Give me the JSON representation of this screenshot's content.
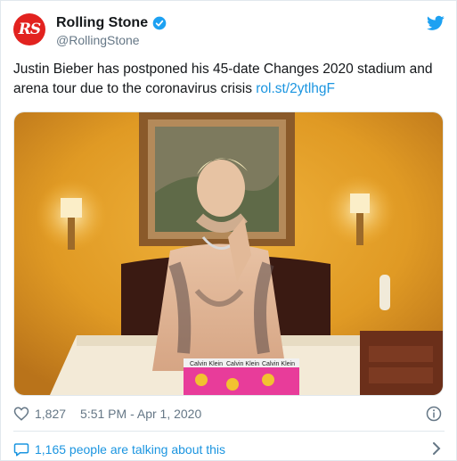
{
  "tweet": {
    "author": {
      "display_name": "Rolling Stone",
      "handle": "@RollingStone",
      "avatar_text": "RS",
      "verified": true
    },
    "text": "Justin Bieber has postponed his 45-date Changes 2020 stadium and arena tour due to the coronavirus crisis ",
    "link": "rol.st/2ytlhgF",
    "media": {
      "underwear_labels": [
        "Calvin Klein",
        "Calvin Klein",
        "Calvin Klein"
      ]
    },
    "likes": "1,827",
    "timestamp": "5:51 PM - Apr 1, 2020",
    "conversation": "1,165 people are talking about this"
  },
  "colors": {
    "brand_red": "#e2221f",
    "twitter_blue": "#1da1f2",
    "link_blue": "#1b95e0",
    "muted_gray": "#657786"
  },
  "icons": {
    "verified": "verified-badge-icon",
    "bird": "twitter-bird-icon",
    "like": "heart-icon",
    "info": "info-icon",
    "reply": "speech-bubble-icon",
    "chevron": "chevron-right-icon"
  }
}
